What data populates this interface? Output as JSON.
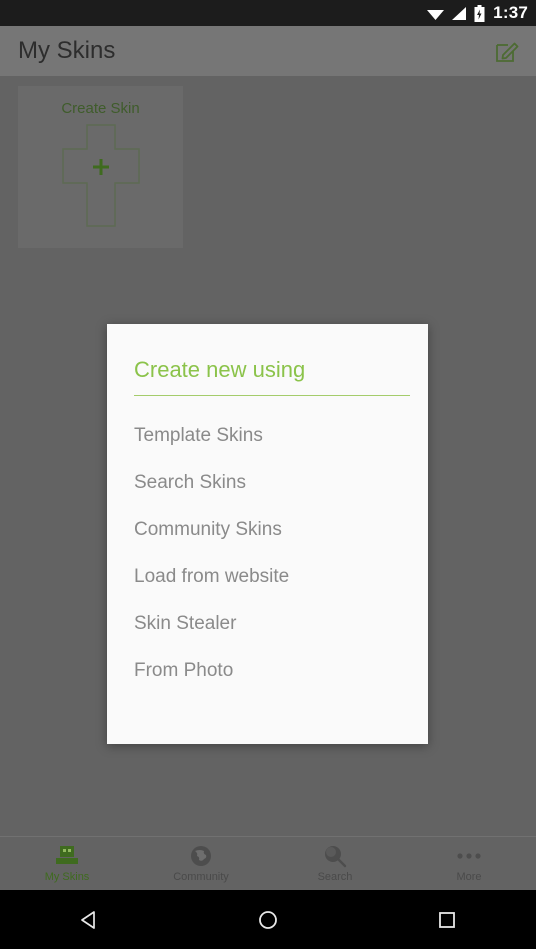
{
  "statusbar": {
    "time": "1:37",
    "icons": [
      "wifi-icon",
      "signal-icon",
      "battery-icon"
    ]
  },
  "appbar": {
    "title": "My Skins",
    "action_icon": "edit-icon"
  },
  "main": {
    "create_card": {
      "label": "Create Skin",
      "icon": "plus-icon"
    }
  },
  "dialog": {
    "title": "Create new using",
    "title_color": "#8bc34a",
    "items": [
      {
        "label": "Template Skins"
      },
      {
        "label": "Search Skins"
      },
      {
        "label": "Community Skins"
      },
      {
        "label": "Load from website"
      },
      {
        "label": "Skin Stealer"
      },
      {
        "label": "From Photo"
      }
    ]
  },
  "bottomnav": {
    "active_color": "#3f6b1f",
    "items": [
      {
        "label": "My Skins",
        "icon": "skin-head-icon",
        "active": true
      },
      {
        "label": "Community",
        "icon": "globe-icon",
        "active": false
      },
      {
        "label": "Search",
        "icon": "magnifier-icon",
        "active": false
      },
      {
        "label": "More",
        "icon": "overflow-dots-icon",
        "active": false
      }
    ]
  },
  "navbar": {
    "back": "back-triangle-icon",
    "home": "home-circle-icon",
    "recents": "recents-square-icon"
  }
}
